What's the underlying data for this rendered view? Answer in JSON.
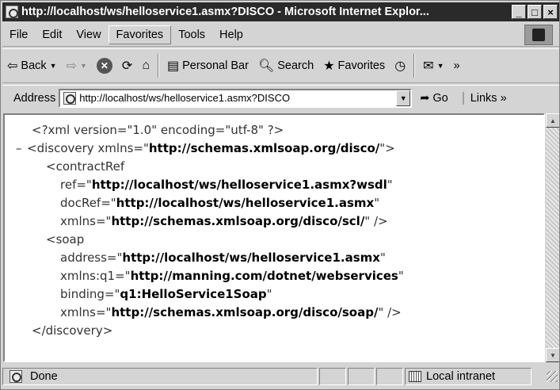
{
  "window": {
    "title": "http://localhost/ws/helloservice1.asmx?DISCO - Microsoft Internet Explor...",
    "controls": {
      "minimize": "_",
      "maximize": "□",
      "close": "×"
    }
  },
  "menubar": {
    "items": [
      "File",
      "Edit",
      "View",
      "Favorites",
      "Tools",
      "Help"
    ],
    "selected": "Favorites"
  },
  "toolbar": {
    "back": "Back",
    "personal_bar": "Personal Bar",
    "search": "Search",
    "favorites": "Favorites",
    "more": "»"
  },
  "address": {
    "label": "Address",
    "url": "http://localhost/ws/helloservice1.asmx?DISCO",
    "go": "Go",
    "links": "Links »"
  },
  "content": {
    "lines": [
      {
        "indent": 0,
        "toggle": "",
        "parts": [
          [
            "t",
            "<?xml version=\"1.0\" encoding=\"utf-8\" ?>"
          ]
        ]
      },
      {
        "indent": 0,
        "toggle": "–",
        "parts": [
          [
            "t",
            "<discovery xmlns=\""
          ],
          [
            "v",
            "http://schemas.xmlsoap.org/disco/"
          ],
          [
            "t",
            "\">"
          ]
        ]
      },
      {
        "indent": 1,
        "toggle": "",
        "parts": [
          [
            "t",
            "<contractRef"
          ]
        ]
      },
      {
        "indent": 2,
        "toggle": "",
        "parts": [
          [
            "t",
            "ref=\""
          ],
          [
            "v",
            "http://localhost/ws/helloservice1.asmx?wsdl"
          ],
          [
            "t",
            "\""
          ]
        ]
      },
      {
        "indent": 2,
        "toggle": "",
        "parts": [
          [
            "t",
            "docRef=\""
          ],
          [
            "v",
            "http://localhost/ws/helloservice1.asmx"
          ],
          [
            "t",
            "\""
          ]
        ]
      },
      {
        "indent": 2,
        "toggle": "",
        "parts": [
          [
            "t",
            "xmlns=\""
          ],
          [
            "v",
            "http://schemas.xmlsoap.org/disco/scl/"
          ],
          [
            "t",
            "\" />"
          ]
        ]
      },
      {
        "indent": 1,
        "toggle": "",
        "parts": [
          [
            "t",
            "<soap"
          ]
        ]
      },
      {
        "indent": 2,
        "toggle": "",
        "parts": [
          [
            "t",
            "address=\""
          ],
          [
            "v",
            "http://localhost/ws/helloservice1.asmx"
          ],
          [
            "t",
            "\""
          ]
        ]
      },
      {
        "indent": 2,
        "toggle": "",
        "parts": [
          [
            "t",
            "xmlns:q1=\""
          ],
          [
            "v",
            "http://manning.com/dotnet/webservices"
          ],
          [
            "t",
            "\""
          ]
        ]
      },
      {
        "indent": 2,
        "toggle": "",
        "parts": [
          [
            "t",
            "binding=\""
          ],
          [
            "v",
            "q1:HelloService1Soap"
          ],
          [
            "t",
            "\""
          ]
        ]
      },
      {
        "indent": 2,
        "toggle": "",
        "parts": [
          [
            "t",
            "xmlns=\""
          ],
          [
            "v",
            "http://schemas.xmlsoap.org/disco/soap/"
          ],
          [
            "t",
            "\" />"
          ]
        ]
      },
      {
        "indent": 0,
        "toggle": "",
        "parts": [
          [
            "t",
            "</discovery>"
          ]
        ]
      }
    ]
  },
  "statusbar": {
    "text": "Done",
    "zone": "Local intranet"
  }
}
